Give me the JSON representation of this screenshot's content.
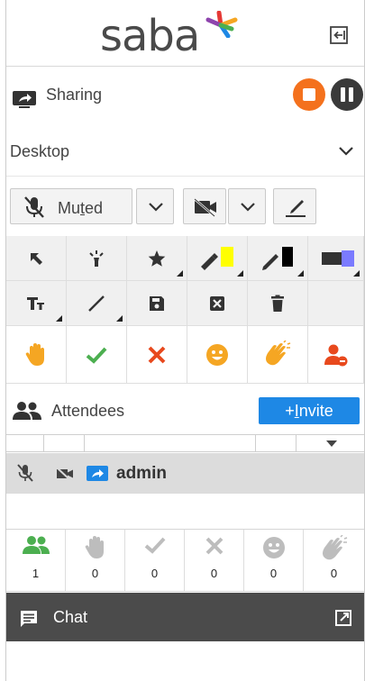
{
  "header": {
    "logo_text": "saba",
    "exit_icon": "exit-icon"
  },
  "sharing": {
    "label": "Sharing",
    "stop_color": "#f4711d",
    "pause_color": "#3a3a3a"
  },
  "source": {
    "selected": "Desktop"
  },
  "audio": {
    "mic_label_prefix": "Mu",
    "mic_label_underline": "t",
    "mic_label_suffix": "ed"
  },
  "tools": {
    "highlight_color": "#ffff00",
    "pen_color": "#000000",
    "shape_colors": [
      "#333333",
      "#7b7bff"
    ]
  },
  "attendees": {
    "label": "Attendees",
    "invite_prefix": "+",
    "invite_underline": "I",
    "invite_suffix": "nvite",
    "rows": [
      {
        "name": "admin"
      }
    ]
  },
  "status": {
    "counts": [
      "1",
      "0",
      "0",
      "0",
      "0",
      "0"
    ],
    "icons": [
      "present-icon",
      "hand-raise-icon",
      "agree-icon",
      "disagree-icon",
      "smile-icon",
      "applause-icon"
    ]
  },
  "chat": {
    "label": "Chat"
  },
  "colors": {
    "accent_blue": "#1e88e5",
    "green": "#4caf50",
    "red": "#e8491d",
    "orange": "#f4711d",
    "chat_bar": "#4b4b4b"
  }
}
